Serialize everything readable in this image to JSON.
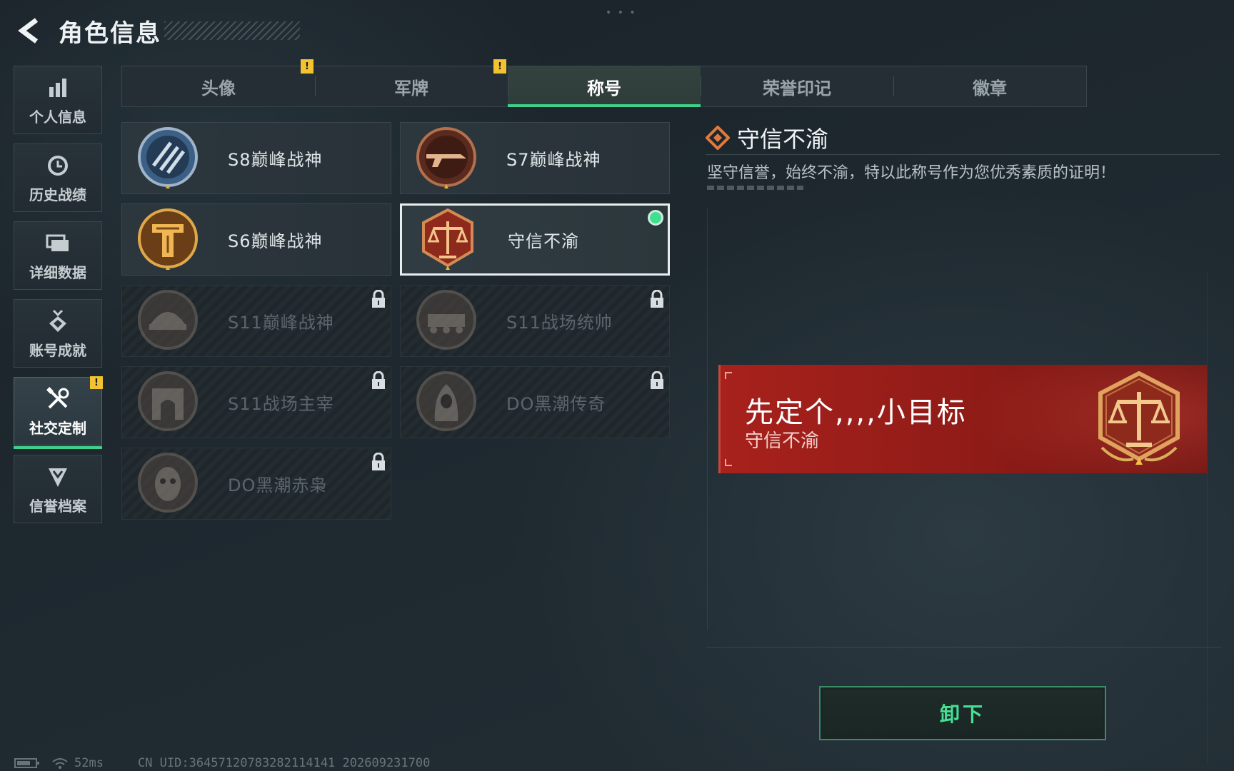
{
  "header": {
    "title": "角色信息",
    "back_icon": "chevron-left-icon"
  },
  "sidebar": {
    "items": [
      {
        "label": "个人信息",
        "icon": "bar-chart-icon",
        "active": false,
        "badge": ""
      },
      {
        "label": "历史战绩",
        "icon": "clock-icon",
        "active": false,
        "badge": ""
      },
      {
        "label": "详细数据",
        "icon": "folders-icon",
        "active": false,
        "badge": ""
      },
      {
        "label": "账号成就",
        "icon": "achievement-icon",
        "active": false,
        "badge": ""
      },
      {
        "label": "社交定制",
        "icon": "tools-icon",
        "active": true,
        "badge": "!"
      },
      {
        "label": "信誉档案",
        "icon": "shield-chevron-icon",
        "active": false,
        "badge": ""
      }
    ]
  },
  "tabs": [
    {
      "label": "头像",
      "active": false,
      "badge": "!"
    },
    {
      "label": "军牌",
      "active": false,
      "badge": "!"
    },
    {
      "label": "称号",
      "active": true,
      "badge": ""
    },
    {
      "label": "荣誉印记",
      "active": false,
      "badge": ""
    },
    {
      "label": "徽章",
      "active": false,
      "badge": ""
    }
  ],
  "titles": [
    {
      "label": "S8巅峰战神",
      "medal": "blue-striped-medal-icon",
      "locked": false,
      "selected": false
    },
    {
      "label": "S7巅峰战神",
      "medal": "rifle-medal-icon",
      "locked": false,
      "selected": false
    },
    {
      "label": "S6巅峰战神",
      "medal": "gold-t-medal-icon",
      "locked": false,
      "selected": false
    },
    {
      "label": "守信不渝",
      "medal": "scales-medal-icon",
      "locked": false,
      "selected": true
    },
    {
      "label": "S11巅峰战神",
      "medal": "helmet-medal-icon",
      "locked": true,
      "selected": false
    },
    {
      "label": "S11战场统帅",
      "medal": "vehicle-medal-icon",
      "locked": true,
      "selected": false
    },
    {
      "label": "S11战场主宰",
      "medal": "arch-medal-icon",
      "locked": true,
      "selected": false
    },
    {
      "label": "DO黑潮传奇",
      "medal": "hooded-figure-medal-icon",
      "locked": true,
      "selected": false
    },
    {
      "label": "DO黑潮赤枭",
      "medal": "owl-medal-icon",
      "locked": true,
      "selected": false
    }
  ],
  "detail": {
    "title": "守信不渝",
    "icon": "diamond-ornament-icon",
    "description": "坚守信誉，始终不渝，特以此称号作为您优秀素质的证明！"
  },
  "banner": {
    "player_name": "先定个,,,,小目标",
    "title_name": "守信不渝",
    "medal": "scales-medal-icon"
  },
  "actions": {
    "unequip_label": "卸下"
  },
  "status": {
    "ping": "52ms",
    "uid": "CN UID:3645712078328211414​1 202609231700"
  },
  "colors": {
    "accent_green": "#3fd08a",
    "badge_yellow": "#f2c230",
    "banner_red": "#a8211c"
  }
}
